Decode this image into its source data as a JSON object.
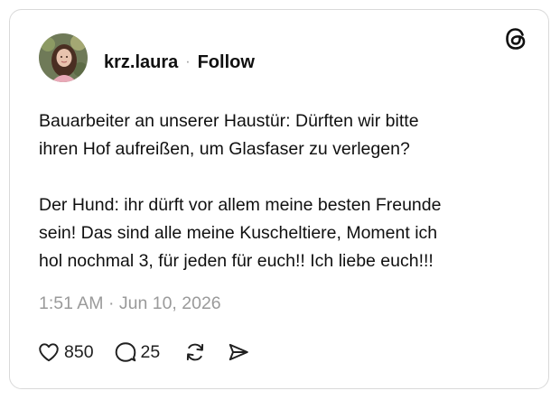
{
  "author": {
    "username": "krz.laura",
    "separator": "·",
    "follow_label": "Follow"
  },
  "post": {
    "text": "Bauarbeiter an unserer Haustür: Dürften wir bitte\nihren Hof aufreißen, um Glasfaser zu verlegen?\n\nDer Hund: ihr dürft vor allem meine besten Freunde\nsein! Das sind alle meine Kuscheltiere, Moment ich\nhol nochmal 3, für jeden für euch!! Ich liebe euch!!!",
    "timestamp": "1:51 AM · Jun 10, 2026"
  },
  "actions": {
    "likes": "850",
    "replies": "25",
    "icons": [
      "heart-icon",
      "reply-icon",
      "repost-icon",
      "share-icon"
    ]
  },
  "icons": {
    "brand": "threads-logo-icon"
  },
  "colors": {
    "text": "#101010",
    "muted": "#9a9a9a",
    "border": "#d9d9d9"
  }
}
